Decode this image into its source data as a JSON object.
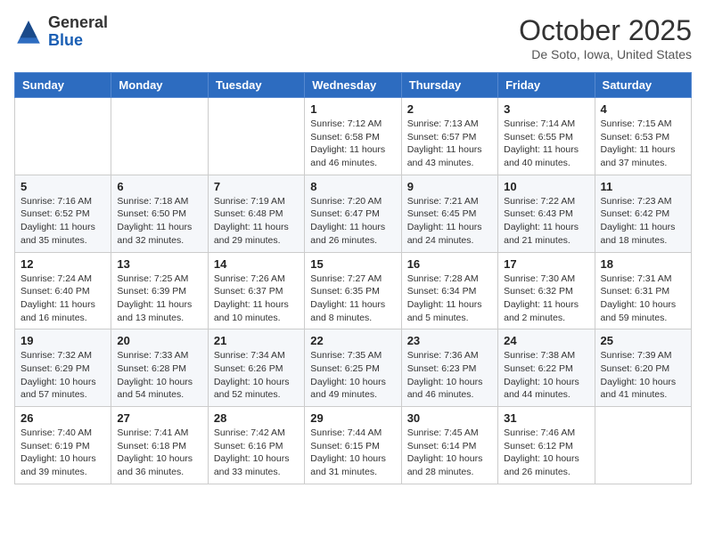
{
  "logo": {
    "general": "General",
    "blue": "Blue"
  },
  "header": {
    "month": "October 2025",
    "location": "De Soto, Iowa, United States"
  },
  "weekdays": [
    "Sunday",
    "Monday",
    "Tuesday",
    "Wednesday",
    "Thursday",
    "Friday",
    "Saturday"
  ],
  "weeks": [
    [
      {
        "day": "",
        "info": ""
      },
      {
        "day": "",
        "info": ""
      },
      {
        "day": "",
        "info": ""
      },
      {
        "day": "1",
        "info": "Sunrise: 7:12 AM\nSunset: 6:58 PM\nDaylight: 11 hours\nand 46 minutes."
      },
      {
        "day": "2",
        "info": "Sunrise: 7:13 AM\nSunset: 6:57 PM\nDaylight: 11 hours\nand 43 minutes."
      },
      {
        "day": "3",
        "info": "Sunrise: 7:14 AM\nSunset: 6:55 PM\nDaylight: 11 hours\nand 40 minutes."
      },
      {
        "day": "4",
        "info": "Sunrise: 7:15 AM\nSunset: 6:53 PM\nDaylight: 11 hours\nand 37 minutes."
      }
    ],
    [
      {
        "day": "5",
        "info": "Sunrise: 7:16 AM\nSunset: 6:52 PM\nDaylight: 11 hours\nand 35 minutes."
      },
      {
        "day": "6",
        "info": "Sunrise: 7:18 AM\nSunset: 6:50 PM\nDaylight: 11 hours\nand 32 minutes."
      },
      {
        "day": "7",
        "info": "Sunrise: 7:19 AM\nSunset: 6:48 PM\nDaylight: 11 hours\nand 29 minutes."
      },
      {
        "day": "8",
        "info": "Sunrise: 7:20 AM\nSunset: 6:47 PM\nDaylight: 11 hours\nand 26 minutes."
      },
      {
        "day": "9",
        "info": "Sunrise: 7:21 AM\nSunset: 6:45 PM\nDaylight: 11 hours\nand 24 minutes."
      },
      {
        "day": "10",
        "info": "Sunrise: 7:22 AM\nSunset: 6:43 PM\nDaylight: 11 hours\nand 21 minutes."
      },
      {
        "day": "11",
        "info": "Sunrise: 7:23 AM\nSunset: 6:42 PM\nDaylight: 11 hours\nand 18 minutes."
      }
    ],
    [
      {
        "day": "12",
        "info": "Sunrise: 7:24 AM\nSunset: 6:40 PM\nDaylight: 11 hours\nand 16 minutes."
      },
      {
        "day": "13",
        "info": "Sunrise: 7:25 AM\nSunset: 6:39 PM\nDaylight: 11 hours\nand 13 minutes."
      },
      {
        "day": "14",
        "info": "Sunrise: 7:26 AM\nSunset: 6:37 PM\nDaylight: 11 hours\nand 10 minutes."
      },
      {
        "day": "15",
        "info": "Sunrise: 7:27 AM\nSunset: 6:35 PM\nDaylight: 11 hours\nand 8 minutes."
      },
      {
        "day": "16",
        "info": "Sunrise: 7:28 AM\nSunset: 6:34 PM\nDaylight: 11 hours\nand 5 minutes."
      },
      {
        "day": "17",
        "info": "Sunrise: 7:30 AM\nSunset: 6:32 PM\nDaylight: 11 hours\nand 2 minutes."
      },
      {
        "day": "18",
        "info": "Sunrise: 7:31 AM\nSunset: 6:31 PM\nDaylight: 10 hours\nand 59 minutes."
      }
    ],
    [
      {
        "day": "19",
        "info": "Sunrise: 7:32 AM\nSunset: 6:29 PM\nDaylight: 10 hours\nand 57 minutes."
      },
      {
        "day": "20",
        "info": "Sunrise: 7:33 AM\nSunset: 6:28 PM\nDaylight: 10 hours\nand 54 minutes."
      },
      {
        "day": "21",
        "info": "Sunrise: 7:34 AM\nSunset: 6:26 PM\nDaylight: 10 hours\nand 52 minutes."
      },
      {
        "day": "22",
        "info": "Sunrise: 7:35 AM\nSunset: 6:25 PM\nDaylight: 10 hours\nand 49 minutes."
      },
      {
        "day": "23",
        "info": "Sunrise: 7:36 AM\nSunset: 6:23 PM\nDaylight: 10 hours\nand 46 minutes."
      },
      {
        "day": "24",
        "info": "Sunrise: 7:38 AM\nSunset: 6:22 PM\nDaylight: 10 hours\nand 44 minutes."
      },
      {
        "day": "25",
        "info": "Sunrise: 7:39 AM\nSunset: 6:20 PM\nDaylight: 10 hours\nand 41 minutes."
      }
    ],
    [
      {
        "day": "26",
        "info": "Sunrise: 7:40 AM\nSunset: 6:19 PM\nDaylight: 10 hours\nand 39 minutes."
      },
      {
        "day": "27",
        "info": "Sunrise: 7:41 AM\nSunset: 6:18 PM\nDaylight: 10 hours\nand 36 minutes."
      },
      {
        "day": "28",
        "info": "Sunrise: 7:42 AM\nSunset: 6:16 PM\nDaylight: 10 hours\nand 33 minutes."
      },
      {
        "day": "29",
        "info": "Sunrise: 7:44 AM\nSunset: 6:15 PM\nDaylight: 10 hours\nand 31 minutes."
      },
      {
        "day": "30",
        "info": "Sunrise: 7:45 AM\nSunset: 6:14 PM\nDaylight: 10 hours\nand 28 minutes."
      },
      {
        "day": "31",
        "info": "Sunrise: 7:46 AM\nSunset: 6:12 PM\nDaylight: 10 hours\nand 26 minutes."
      },
      {
        "day": "",
        "info": ""
      }
    ]
  ]
}
